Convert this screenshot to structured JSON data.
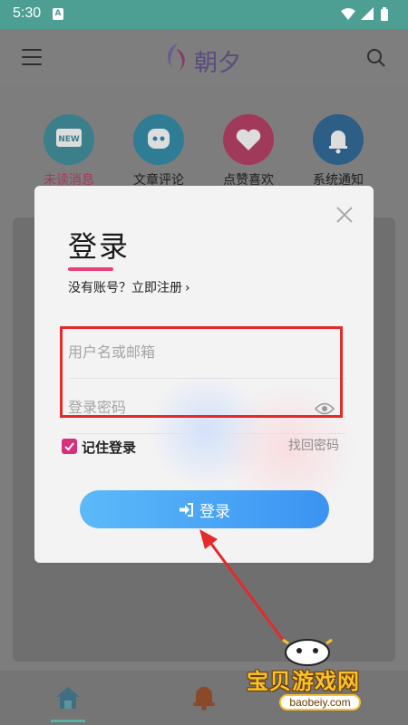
{
  "status_bar": {
    "time": "5:30",
    "sim_label": "A"
  },
  "header": {
    "app_title": "朝夕"
  },
  "categories": [
    {
      "label": "未读消息",
      "icon": "new-message-icon",
      "color": "#3a7f8a",
      "active": true
    },
    {
      "label": "文章评论",
      "icon": "comment-icon",
      "color": "#2f7d94"
    },
    {
      "label": "点赞喜欢",
      "icon": "heart-icon",
      "color": "#a13a5a"
    },
    {
      "label": "系统通知",
      "icon": "bell-icon",
      "color": "#2d5e86"
    }
  ],
  "dialog": {
    "title": "登录",
    "register_link": "没有账号？立即注册",
    "username_placeholder": "用户名或邮箱",
    "password_placeholder": "登录密码",
    "remember_label": "记住登录",
    "remember_checked": true,
    "forgot_label": "找回密码",
    "login_button": "登录"
  },
  "bottom_nav": {
    "items": [
      "home-icon",
      "bell-icon"
    ]
  },
  "watermark": {
    "title": "宝贝游戏网",
    "url": "baobeiy.com"
  },
  "colors": {
    "accent_pink": "#e8407b",
    "button_start": "#5cb9f9",
    "button_end": "#3b93f2",
    "highlight_red": "#e42a2a",
    "status_bar": "#4d9e93"
  }
}
